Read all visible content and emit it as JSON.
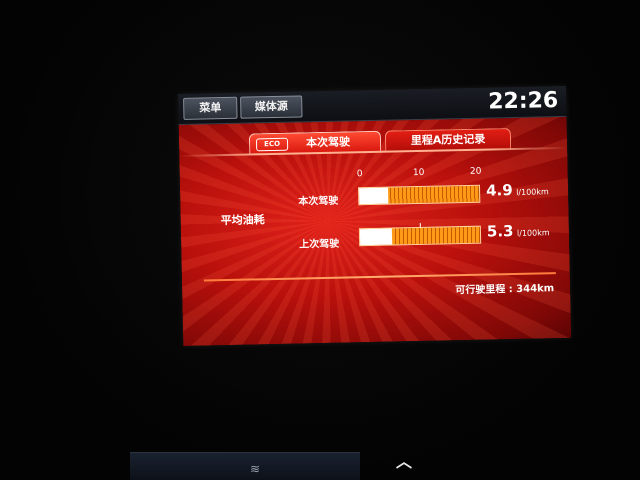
{
  "topbar": {
    "menu_label": "菜单",
    "source_label": "媒体源",
    "clock": "22:26"
  },
  "tabs": [
    {
      "label": "本次驾驶",
      "badge": "ECO",
      "active": true
    },
    {
      "label": "里程A历史记录",
      "active": false
    }
  ],
  "fuel": {
    "section_label": "平均油耗",
    "scale_ticks": [
      "0",
      "10",
      "20"
    ],
    "scale_max": 20,
    "rows": [
      {
        "label": "本次驾驶",
        "value": "4.9",
        "numeric": 4.9,
        "unit": "l/100km"
      },
      {
        "label": "上次驾驶",
        "value": "5.3",
        "numeric": 5.3,
        "unit": "l/100km"
      }
    ]
  },
  "range": {
    "text": "可行驶里程 : 344km"
  },
  "colors": {
    "accent_red": "#d8170e",
    "bar_orange": "#ff9a18",
    "fill_white": "#ffffff"
  },
  "icons": {
    "console_icon": "seat-heat-icon",
    "chevron": "chevron-up-icon"
  }
}
